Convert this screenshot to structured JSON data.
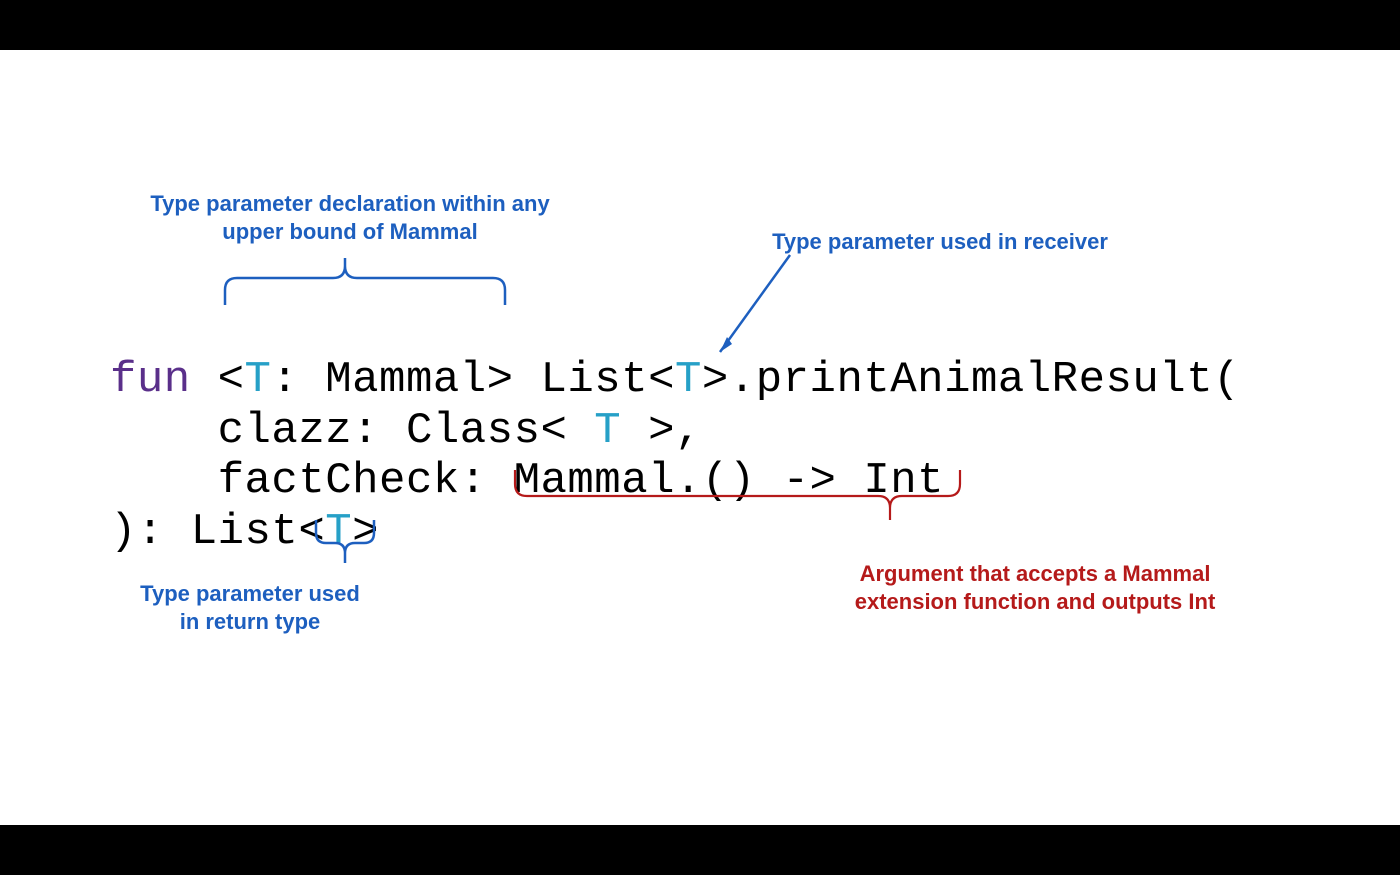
{
  "annotations": {
    "typeParamDecl_l1": "Type parameter declaration within any",
    "typeParamDecl_l2": "upper bound of Mammal",
    "receiverUse": "Type parameter used in receiver",
    "returnUse_l1": "Type parameter used",
    "returnUse_l2": "in return type",
    "lambdaArg_l1": "Argument that accepts a Mammal",
    "lambdaArg_l2": "extension function and outputs Int"
  },
  "code": {
    "fun": "fun ",
    "lt1": "<",
    "T1": "T",
    "colonMammal": ": Mammal",
    "gt1": "> ",
    "list1": "List<",
    "T2": "T",
    "gt2": ">",
    "dotPrint": ".printAnimalResult(",
    "indent": "    ",
    "clazz": "clazz: Class< ",
    "T3": "T",
    "gtComma": " >,",
    "factCheck": "factCheck: Mammal.() -> Int",
    "closeParen": "): List<",
    "T4": "T",
    "gt3": ">"
  },
  "colors": {
    "keyword": "#5a2f8a",
    "typeParam": "#26a0c7",
    "blueAnn": "#1d5fbf",
    "redAnn": "#b51a1a"
  }
}
